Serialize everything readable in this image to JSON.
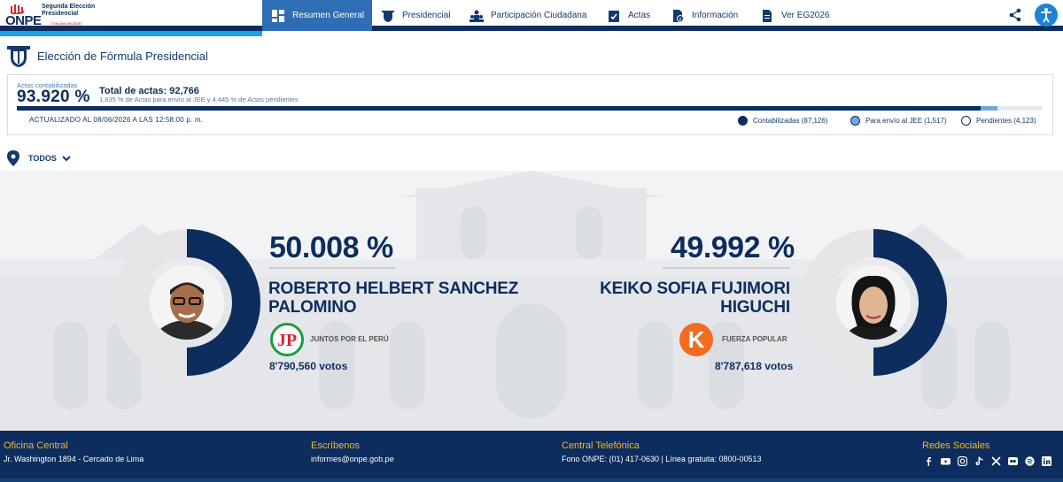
{
  "header": {
    "logo_text": "ONPE",
    "logo_title": "Segunda Elección Presidencial",
    "logo_date": "7 de junio de 2026",
    "nav": [
      {
        "label": "Resumen General",
        "active": true
      },
      {
        "label": "Presidencial"
      },
      {
        "label": "Participación Ciudadana"
      },
      {
        "label": "Actas"
      },
      {
        "label": "Información"
      },
      {
        "label": "Ver EG2026"
      }
    ],
    "icons": [
      "share-icon",
      "accessibility-icon"
    ]
  },
  "page": {
    "title": "Elección de Fórmula Presidencial"
  },
  "summary": {
    "actas_label": "Actas contabilizadas",
    "actas_pct": "93.920 %",
    "total_label": "Total de actas: 92,766",
    "sub_note": "1.635 % de Actas para envío al JEE y 4.445 % de Actas pendientes",
    "updated": "ACTUALIZADO AL 08/06/2026 A LAS 12:58:00 p. m.",
    "progress": {
      "contabilizadas": 0.9392,
      "jee": 0.01635,
      "pendientes": 0.04445
    },
    "legend": [
      {
        "label": "Contabilizadas (87,126)",
        "color": "#0d2d5e"
      },
      {
        "label": "Para envío al JEE (1,517)",
        "color": "#6fa8dc"
      },
      {
        "label": "Pendientes (4,123)",
        "color": "#ffffff"
      }
    ]
  },
  "filter": {
    "label": "TODOS"
  },
  "candidates": [
    {
      "pct": "50.008 %",
      "pct_value": 50.008,
      "name_line1": "ROBERTO HELBERT SANCHEZ",
      "name_line2": "PALOMINO",
      "party": "JUNTOS POR EL PERÚ",
      "party_logo_text": "JP",
      "votes": "8'790,560 votos",
      "color": "#0d2d5e"
    },
    {
      "pct": "49.992 %",
      "pct_value": 49.992,
      "name_line1": "KEIKO SOFIA FUJIMORI",
      "name_line2": "HIGUCHI",
      "party": "FUERZA POPULAR",
      "party_logo_text": "K",
      "votes": "8'787,618 votos",
      "color": "#0d2d5e"
    }
  ],
  "footer": {
    "office_heading": "Oficina Central",
    "office_text": "Jr. Washington 1894 - Cercado de Lima",
    "write_heading": "Escríbenos",
    "write_text": "informes@onpe.gob.pe",
    "phone_heading": "Central Telefónica",
    "phone_text": "Fono ONPE: (01) 417-0630 | Línea gratuita: 0800-00513",
    "social_heading": "Redes Sociales",
    "social_icons": [
      "facebook-icon",
      "youtube-icon",
      "instagram-icon",
      "tiktok-icon",
      "x-icon",
      "flickr-icon",
      "spotify-icon",
      "linkedin-icon"
    ]
  }
}
